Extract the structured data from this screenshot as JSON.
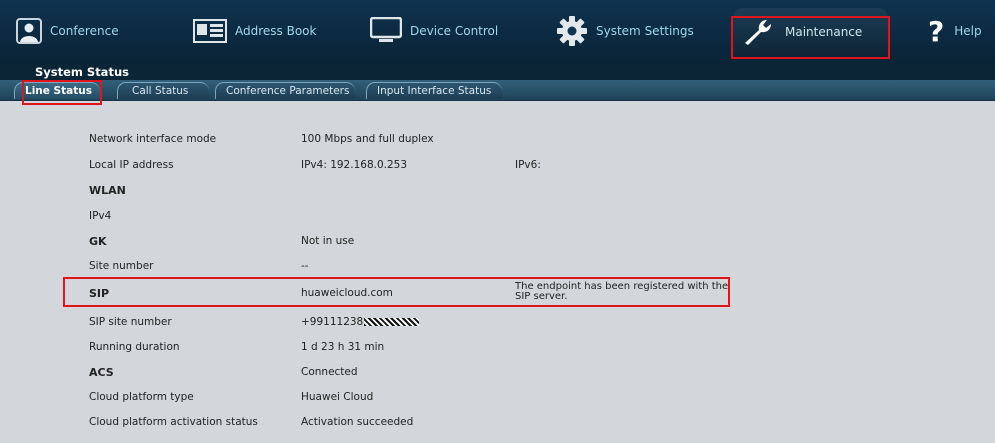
{
  "nav": {
    "items": [
      {
        "id": "conference",
        "label": "Conference",
        "icon": "conference-icon"
      },
      {
        "id": "address-book",
        "label": "Address Book",
        "icon": "address-book-icon"
      },
      {
        "id": "device-control",
        "label": "Device Control",
        "icon": "monitor-icon"
      },
      {
        "id": "system-settings",
        "label": "System Settings",
        "icon": "gear-icon"
      },
      {
        "id": "maintenance",
        "label": "Maintenance",
        "icon": "wrench-icon",
        "active": true
      },
      {
        "id": "help",
        "label": "Help",
        "icon": "help-icon"
      }
    ]
  },
  "section_title": "System Status",
  "tabs": [
    {
      "label": "Line Status",
      "active": true
    },
    {
      "label": "Call Status"
    },
    {
      "label": "Conference Parameters"
    },
    {
      "label": "Input Interface Status"
    }
  ],
  "rows": [
    {
      "label": "Network interface mode",
      "value": "100 Mbps and full duplex",
      "extra": ""
    },
    {
      "label": "Local IP address",
      "value": "IPv4: 192.168.0.253",
      "extra": "IPv6:"
    },
    {
      "label": "WLAN",
      "value": "",
      "extra": "",
      "bold": true
    },
    {
      "label": "IPv4",
      "value": "",
      "extra": ""
    },
    {
      "label": "GK",
      "value": "Not in use",
      "extra": "",
      "bold": true
    },
    {
      "label": "Site number",
      "value": "--",
      "extra": ""
    },
    {
      "label": "SIP",
      "value": "huaweicloud.com",
      "extra": "The endpoint has been registered with the SIP server.",
      "bold": true
    },
    {
      "label": "SIP site number",
      "value": "+99111238",
      "extra": "",
      "masked": true
    },
    {
      "label": "Running duration",
      "value": "1 d  23 h  31 min",
      "extra": ""
    },
    {
      "label": "ACS",
      "value": "Connected",
      "extra": "",
      "bold": true
    },
    {
      "label": "Cloud platform type",
      "value": "Huawei Cloud",
      "extra": ""
    },
    {
      "label": "Cloud platform activation status",
      "value": "Activation succeeded",
      "extra": ""
    }
  ],
  "colors": {
    "highlight": "#e0141a",
    "nav_text": "#9fd8e8",
    "nav_bg": "#0f3350"
  }
}
